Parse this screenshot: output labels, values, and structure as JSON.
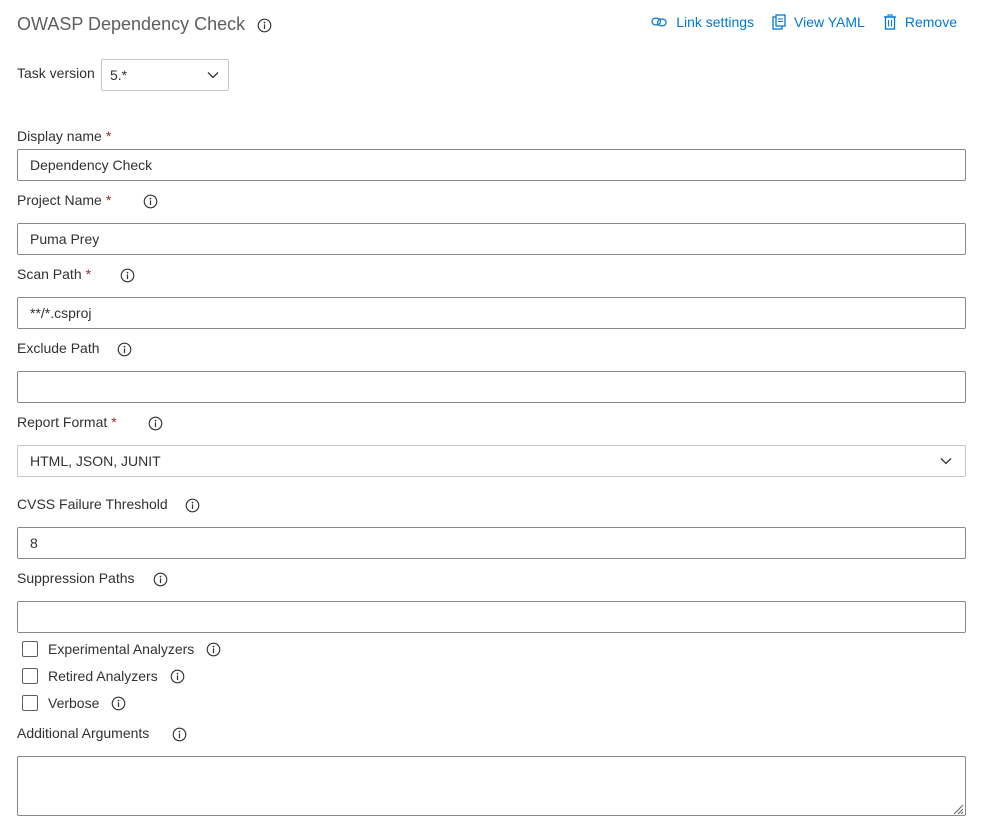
{
  "header": {
    "title": "OWASP Dependency Check",
    "actions": [
      {
        "label": "Link settings",
        "icon": "link-icon"
      },
      {
        "label": "View YAML",
        "icon": "clipboard-icon"
      },
      {
        "label": "Remove",
        "icon": "trash-icon"
      }
    ]
  },
  "task_version": {
    "label": "Task version",
    "value": "5.*"
  },
  "fields": {
    "display_name": {
      "label": "Display name",
      "value": "Dependency Check",
      "required": true
    },
    "project_name": {
      "label": "Project Name",
      "value": "Puma Prey",
      "required": true
    },
    "scan_path": {
      "label": "Scan Path",
      "value": "**/*.csproj",
      "required": true
    },
    "exclude_path": {
      "label": "Exclude Path",
      "value": ""
    },
    "report_format": {
      "label": "Report Format",
      "value": "HTML, JSON, JUNIT",
      "required": true
    },
    "cvss_threshold": {
      "label": "CVSS Failure Threshold",
      "value": "8"
    },
    "suppression_paths": {
      "label": "Suppression Paths",
      "value": ""
    },
    "additional_arguments": {
      "label": "Additional Arguments",
      "value": ""
    }
  },
  "checkboxes": [
    {
      "label": "Experimental Analyzers",
      "checked": false
    },
    {
      "label": "Retired Analyzers",
      "checked": false
    },
    {
      "label": "Verbose",
      "checked": false
    }
  ],
  "required_marker": "*",
  "colors": {
    "accent": "#0078d4",
    "required": "#a4262c",
    "border": "#8a8886"
  }
}
